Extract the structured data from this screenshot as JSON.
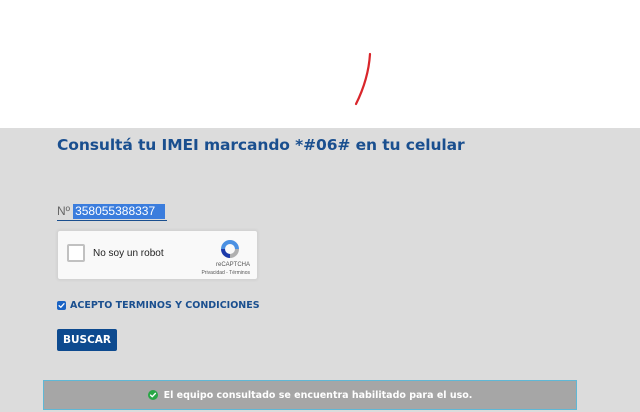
{
  "heading": {
    "title": "Consultá tu IMEI marcando *#06# en tu celular"
  },
  "imei": {
    "prefix": "Nº",
    "value": "358055388337"
  },
  "recaptcha": {
    "label": "No soy un robot",
    "brand": "reCAPTCHA",
    "links": "Privacidad - Términos",
    "checked": false
  },
  "terms": {
    "label": "ACEPTO TERMINOS Y CONDICIONES",
    "checked": true
  },
  "search": {
    "button_label": "BUSCAR"
  },
  "result": {
    "message": "El equipo consultado se encuentra habilitado para el uso.",
    "icon": "check-circle-icon"
  },
  "colors": {
    "title": "#1a4f8f",
    "button": "#0d4a8f",
    "checkbox": "#1a63c4",
    "success": "#28a745",
    "alert_background": "#a6a6a6",
    "alert_border": "#5fb8d6",
    "mark": "#d9262b"
  }
}
